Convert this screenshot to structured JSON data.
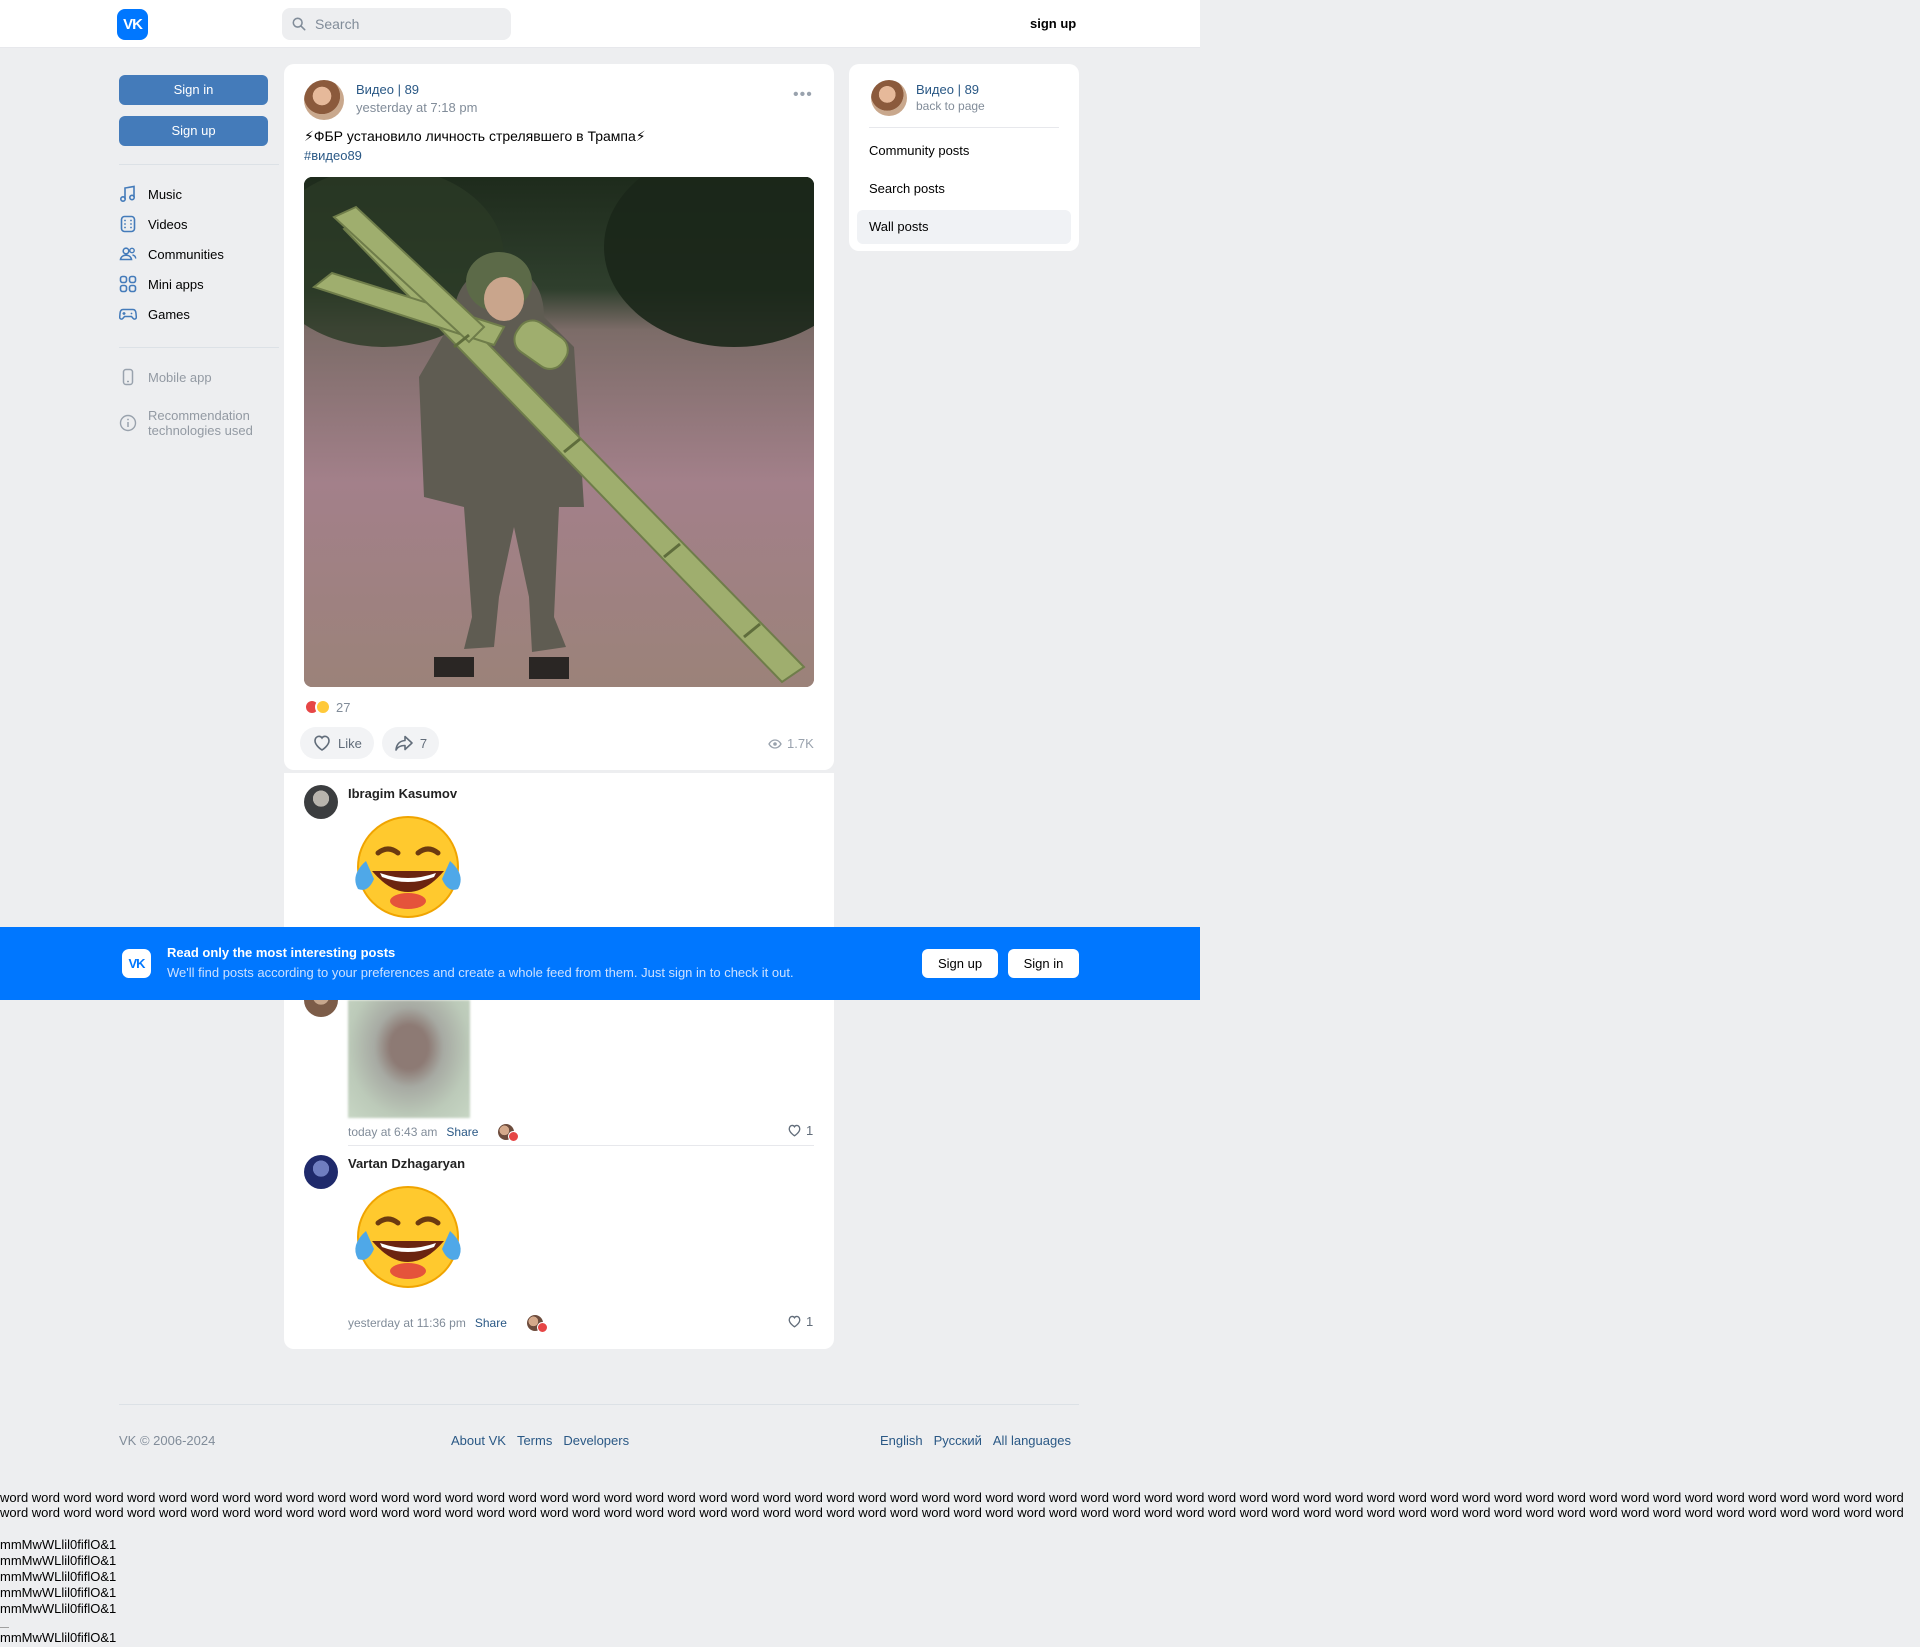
{
  "header": {
    "logo": "VK",
    "search_placeholder": "Search",
    "signup": "sign up"
  },
  "sidebar": {
    "sign_in": "Sign in",
    "sign_up": "Sign up",
    "items": [
      {
        "label": "Music",
        "icon": "music-icon"
      },
      {
        "label": "Videos",
        "icon": "video-icon"
      },
      {
        "label": "Communities",
        "icon": "users-icon"
      },
      {
        "label": "Mini apps",
        "icon": "grid-icon"
      },
      {
        "label": "Games",
        "icon": "gamepad-icon"
      }
    ],
    "mobile_app": "Mobile app",
    "recommendation": [
      "Recommendation",
      "technologies used"
    ]
  },
  "post": {
    "author": "Видео | 89",
    "time": "yesterday at 7:18 pm",
    "more": "•••",
    "text": "⚡ФБР установило личность стрелявшего в Трампа⚡",
    "hashtag": "#видео89",
    "reactions_count": "27",
    "like_label": "Like",
    "shares_count": "7",
    "views": "1.7K",
    "colors": {
      "accent": "#0077ff",
      "link": "#2a5885"
    }
  },
  "comments": [
    {
      "name": "Ibragim Kasumov",
      "emoji": "face-with-tears-of-joy"
    },
    {
      "time": "today at 6:43 am",
      "share": "Share",
      "likes": "1"
    },
    {
      "name": "Vartan Dzhagaryan",
      "emoji": "face-with-tears-of-joy",
      "time": "yesterday at 11:36 pm",
      "share": "Share",
      "likes": "1"
    }
  ],
  "right_panel": {
    "title": "Видео | 89",
    "subtitle": "back to page",
    "items": [
      "Community posts",
      "Search posts",
      "Wall posts"
    ],
    "active": "Wall posts"
  },
  "banner": {
    "title": "Read only the most interesting posts",
    "text": "We'll find posts according to your preferences and create a whole feed from them. Just sign in to check it out.",
    "sign_up": "Sign up",
    "sign_in": "Sign in"
  },
  "footer": {
    "copyright": "VK © 2006-2024",
    "links": [
      "About VK",
      "Terms",
      "Developers"
    ],
    "languages": [
      "English",
      "Русский",
      "All languages"
    ]
  },
  "test_text": {
    "word": "word",
    "line": "mmMwWLlil0fiflO&1"
  }
}
